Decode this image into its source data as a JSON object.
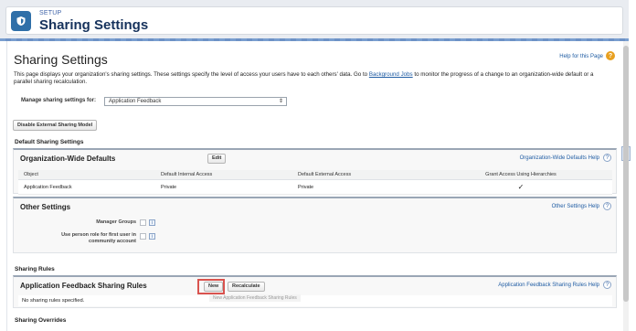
{
  "header": {
    "eyebrow": "SETUP",
    "title": "Sharing Settings"
  },
  "page": {
    "title": "Sharing Settings",
    "help_link": "Help for this Page",
    "intro_before": "This page displays your organization's sharing settings. These settings specify the level of access your users have to each others' data. Go to ",
    "intro_link": "Background Jobs",
    "intro_after": " to monitor the progress of a change to an organization-wide default or a parallel sharing recalculation."
  },
  "manage": {
    "label": "Manage sharing settings for:",
    "selected": "Application Feedback"
  },
  "buttons": {
    "disable_external": "Disable External Sharing Model",
    "edit": "Edit",
    "new": "New",
    "recalculate": "Recalculate"
  },
  "owd": {
    "section_label": "Default Sharing Settings",
    "title": "Organization-Wide Defaults",
    "help": "Organization-Wide Defaults Help",
    "columns": [
      "Object",
      "Default Internal Access",
      "Default External Access",
      "Grant Access Using Hierarchies"
    ],
    "rows": [
      {
        "object": "Application Feedback",
        "internal": "Private",
        "external": "Private",
        "grant": "✓"
      }
    ]
  },
  "other_settings": {
    "title": "Other Settings",
    "help": "Other Settings Help",
    "manager_groups": "Manager Groups",
    "person_role_line1": "Use person role for first user in",
    "person_role_line2": "community account"
  },
  "sharing_rules": {
    "section_label": "Sharing Rules",
    "title": "Application Feedback Sharing Rules",
    "help": "Application Feedback Sharing Rules Help",
    "empty": "No sharing rules specified.",
    "tooltip": "New Application Feedback Sharing Rules"
  },
  "overrides": {
    "section_label": "Sharing Overrides"
  },
  "icons": {
    "setup": "shield-icon",
    "help": "question-icon",
    "info": "info-icon",
    "dropdown": "chevron-down-icon"
  },
  "colors": {
    "brand": "#2f6fa8",
    "title": "#16325c",
    "link": "#1f5ca3",
    "highlight": "#d9534f",
    "help_orange": "#e8a020"
  }
}
